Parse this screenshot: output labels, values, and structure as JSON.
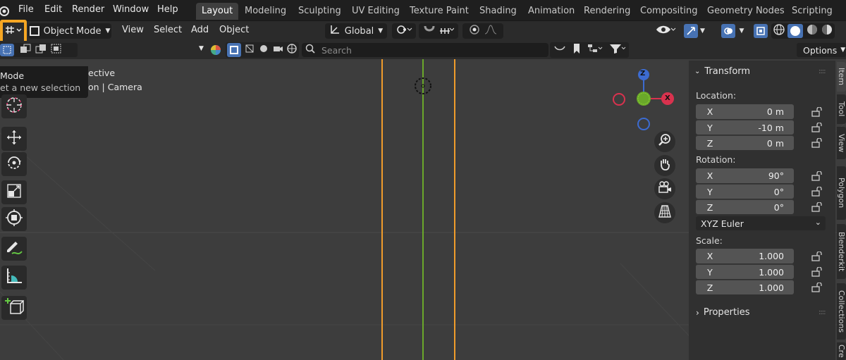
{
  "menu": [
    "File",
    "Edit",
    "Render",
    "Window",
    "Help"
  ],
  "workspaces": [
    "Layout",
    "Modeling",
    "Sculpting",
    "UV Editing",
    "Texture Paint",
    "Shading",
    "Animation",
    "Rendering",
    "Compositing",
    "Geometry Nodes",
    "Scripting"
  ],
  "header": {
    "mode": "Object Mode",
    "menus": [
      "View",
      "Select",
      "Add",
      "Object"
    ],
    "orientation": "Global"
  },
  "search": {
    "placeholder": "Search"
  },
  "options_label": "Options",
  "tooltip": {
    "title": "Mode",
    "desc": "et a new selection"
  },
  "viewport_overlay": {
    "line1": "ective",
    "line2": "on | Camera"
  },
  "gizmo": {
    "z": "Z",
    "x": "X"
  },
  "transform": {
    "title": "Transform",
    "location_label": "Location:",
    "location": [
      {
        "axis": "X",
        "value": "0 m"
      },
      {
        "axis": "Y",
        "value": "-10 m"
      },
      {
        "axis": "Z",
        "value": "0 m"
      }
    ],
    "rotation_label": "Rotation:",
    "rotation": [
      {
        "axis": "X",
        "value": "90°"
      },
      {
        "axis": "Y",
        "value": "0°"
      },
      {
        "axis": "Z",
        "value": "0°"
      }
    ],
    "rotation_mode": "XYZ Euler",
    "scale_label": "Scale:",
    "scale": [
      {
        "axis": "X",
        "value": "1.000"
      },
      {
        "axis": "Y",
        "value": "1.000"
      },
      {
        "axis": "Z",
        "value": "1.000"
      }
    ]
  },
  "properties_title": "Properties",
  "side_tabs": [
    "Item",
    "Tool",
    "View",
    "Polygon",
    "Blenderkit",
    "Collections",
    "Cre"
  ],
  "colors": {
    "highlight": "#f5a623",
    "accent": "#4772b3",
    "y_axis": "#6aa82a",
    "camera": "#f09c2b"
  }
}
